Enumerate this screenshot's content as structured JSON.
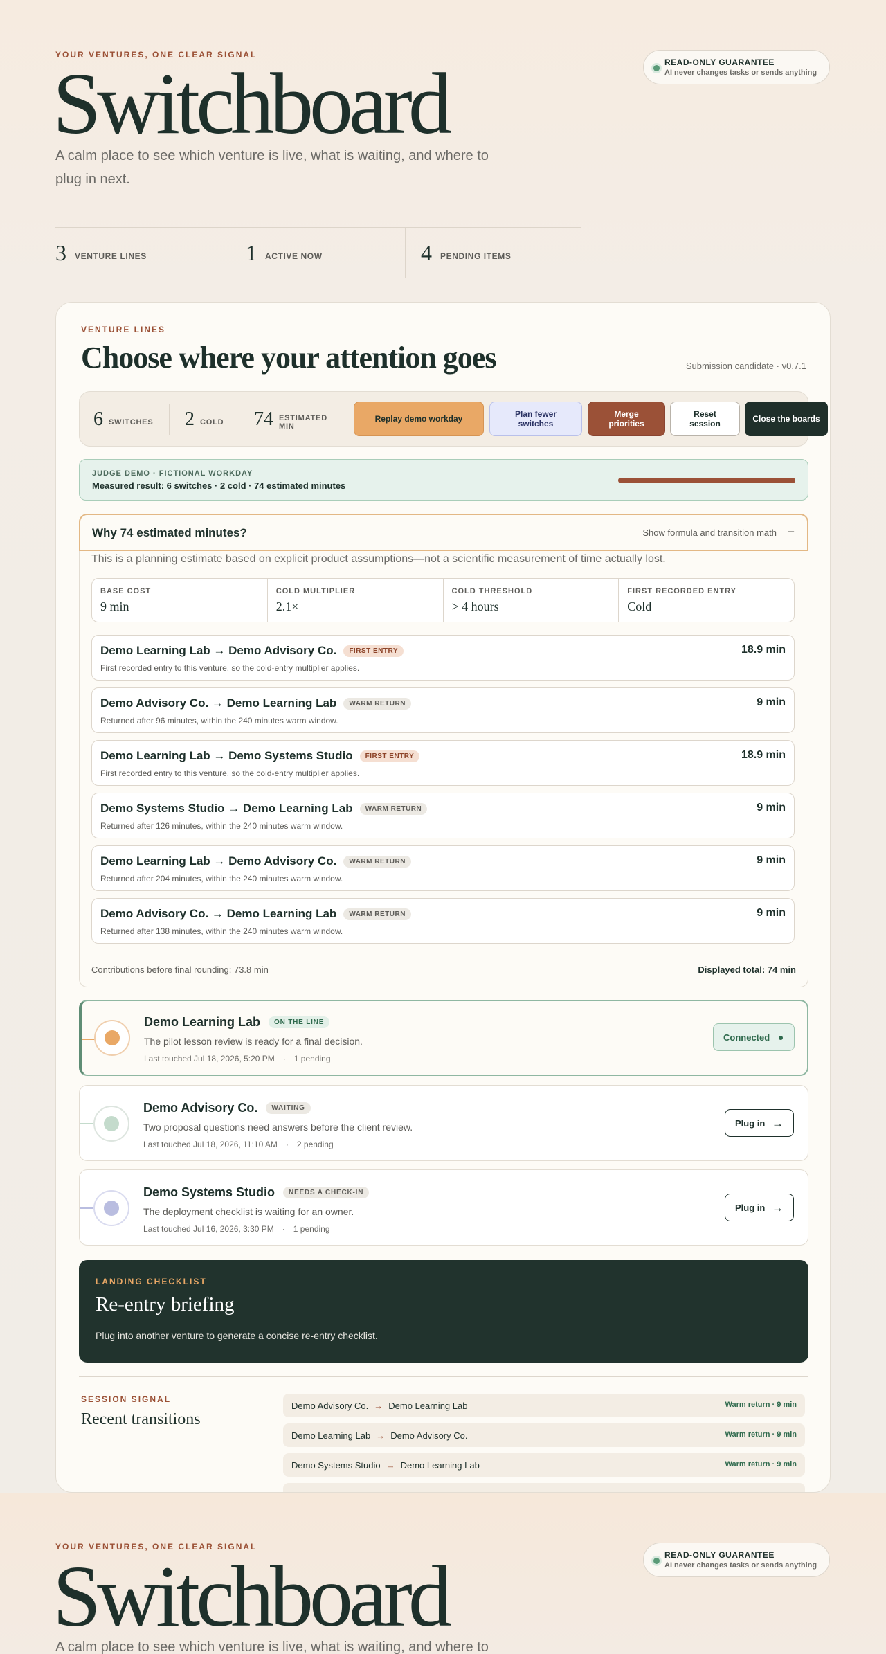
{
  "hero": {
    "eyebrow": "YOUR VENTURES, ONE CLEAR SIGNAL",
    "title": "Switchboard",
    "lede": "A calm place to see which venture is live, what is waiting, and where to plug in next.",
    "guarantee_title": "READ-ONLY GUARANTEE",
    "guarantee_text": "AI never changes tasks or sends anything",
    "stats": [
      {
        "value": "3",
        "label": "VENTURE LINES"
      },
      {
        "value": "1",
        "label": "ACTIVE NOW"
      },
      {
        "value": "4",
        "label": "PENDING ITEMS"
      }
    ]
  },
  "card": {
    "eyebrow": "VENTURE LINES",
    "title": "Choose where your attention goes",
    "version": "Submission candidate · v0.7.1",
    "toolbar": {
      "stats": [
        {
          "value": "6",
          "label": "SWITCHES"
        },
        {
          "value": "2",
          "label": "COLD"
        },
        {
          "value": "74",
          "label": "ESTIMATED MIN"
        }
      ],
      "buttons": {
        "replay": "Replay demo workday",
        "plan": "Plan fewer switches",
        "merge": "Merge priorities",
        "reset": "Reset session",
        "close": "Close the boards"
      }
    },
    "demo": {
      "label": "JUDGE DEMO · FICTIONAL WORKDAY",
      "result": "Measured result: 6 switches · 2 cold · 74 estimated minutes",
      "progress": 1.0
    },
    "why": {
      "title": "Why 74 estimated minutes?",
      "toggle_label": "Show formula and transition math",
      "toggle_icon": "−",
      "intro": "This is a planning estimate based on explicit product assumptions—not a scientific measurement of time actually lost.",
      "params": [
        {
          "label": "BASE COST",
          "value": "9 min"
        },
        {
          "label": "COLD MULTIPLIER",
          "value": "2.1×"
        },
        {
          "label": "COLD THRESHOLD",
          "value": "> 4 hours"
        },
        {
          "label": "FIRST RECORDED ENTRY",
          "value": "Cold"
        }
      ],
      "transitions": [
        {
          "title": "Demo Learning Lab → Demo Advisory Co.",
          "tag": "FIRST ENTRY",
          "kind": "first",
          "desc": "First recorded entry to this venture, so the cold-entry multiplier applies.",
          "minutes": "18.9 min"
        },
        {
          "title": "Demo Advisory Co. → Demo Learning Lab",
          "tag": "WARM RETURN",
          "kind": "warm",
          "desc": "Returned after 96 minutes, within the 240 minutes warm window.",
          "minutes": "9 min"
        },
        {
          "title": "Demo Learning Lab → Demo Systems Studio",
          "tag": "FIRST ENTRY",
          "kind": "first",
          "desc": "First recorded entry to this venture, so the cold-entry multiplier applies.",
          "minutes": "18.9 min"
        },
        {
          "title": "Demo Systems Studio → Demo Learning Lab",
          "tag": "WARM RETURN",
          "kind": "warm",
          "desc": "Returned after 126 minutes, within the 240 minutes warm window.",
          "minutes": "9 min"
        },
        {
          "title": "Demo Learning Lab → Demo Advisory Co.",
          "tag": "WARM RETURN",
          "kind": "warm",
          "desc": "Returned after 204 minutes, within the 240 minutes warm window.",
          "minutes": "9 min"
        },
        {
          "title": "Demo Advisory Co. → Demo Learning Lab",
          "tag": "WARM RETURN",
          "kind": "warm",
          "desc": "Returned after 138 minutes, within the 240 minutes warm window.",
          "minutes": "9 min"
        }
      ],
      "contributions": "Contributions before final rounding: 73.8 min",
      "total": "Displayed total: 74 min"
    },
    "ventures": [
      {
        "name": "Demo Learning Lab",
        "status": "ON THE LINE",
        "desc": "The pilot lesson review is ready for a final decision.",
        "touched": "Last touched Jul 18, 2026, 5:20 PM",
        "sep": "·",
        "pending": "1 pending",
        "action": "Connected",
        "color": "#e9a866",
        "ring": "#f0cfae",
        "tag_bg": "#e3f0e8",
        "tag_fg": "#2f6a4d"
      },
      {
        "name": "Demo Advisory Co.",
        "status": "WAITING",
        "desc": "Two proposal questions need answers before the client review.",
        "touched": "Last touched Jul 18, 2026, 11:10 AM",
        "sep": "·",
        "pending": "2 pending",
        "action": "Plug in",
        "arrow": "→",
        "color": "#c4dbcc",
        "ring": "#dde5df",
        "tag_bg": "#ece9e3",
        "tag_fg": "#5d5c58"
      },
      {
        "name": "Demo Systems Studio",
        "status": "NEEDS A CHECK-IN",
        "desc": "The deployment checklist is waiting for an owner.",
        "touched": "Last touched Jul 16, 2026, 3:30 PM",
        "sep": "·",
        "pending": "1 pending",
        "action": "Plug in",
        "arrow": "→",
        "color": "#b9bde0",
        "ring": "#d9dbef",
        "tag_bg": "#ece9e3",
        "tag_fg": "#5d5c58"
      }
    ],
    "briefing": {
      "eyebrow": "LANDING CHECKLIST",
      "title": "Re-entry briefing",
      "desc": "Plug into another venture to generate a concise re-entry checklist."
    },
    "session": {
      "eyebrow": "SESSION SIGNAL",
      "title": "Recent transitions",
      "items": [
        {
          "from": "Demo Advisory Co.",
          "to": "Demo Learning Lab",
          "result": "Warm return · 9 min"
        },
        {
          "from": "Demo Learning Lab",
          "to": "Demo Advisory Co.",
          "result": "Warm return · 9 min"
        },
        {
          "from": "Demo Systems Studio",
          "to": "Demo Learning Lab",
          "result": "Warm return · 9 min"
        }
      ]
    }
  }
}
